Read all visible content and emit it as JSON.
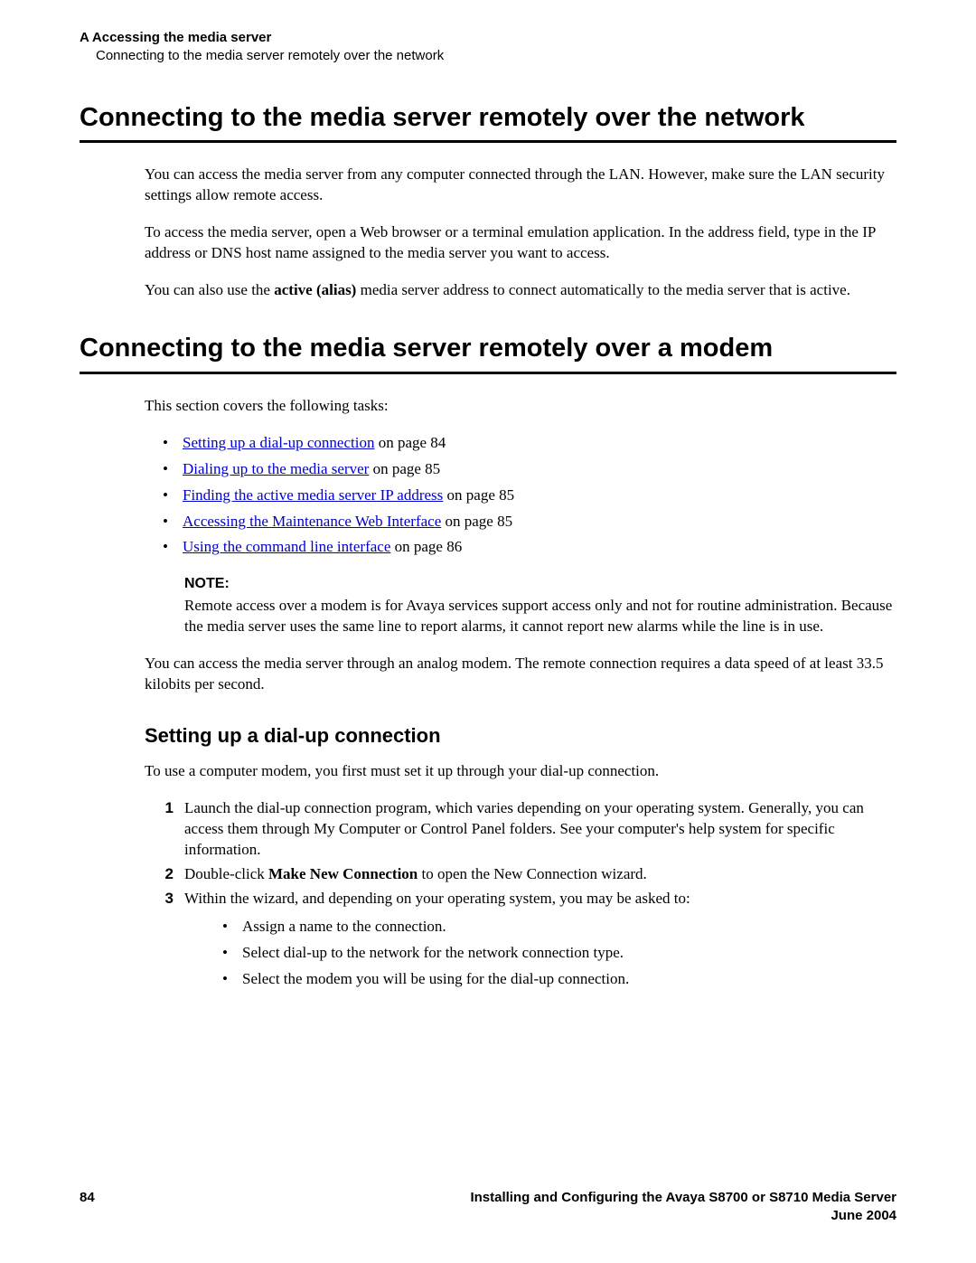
{
  "header": {
    "appendix": "A",
    "chapter": "Accessing the media server",
    "subtitle": "Connecting to the media server remotely over the network"
  },
  "section1": {
    "title": "Connecting to the media server remotely over the network",
    "p1": "You can access the media server from any computer connected through the LAN. However, make sure the LAN security settings allow remote access.",
    "p2": "To access the media server, open a Web browser or a terminal emulation application. In the address field, type in the IP address or DNS host name assigned to the media server you want to access.",
    "p3a": "You can also use the ",
    "p3bold": "active (alias)",
    "p3b": " media server address to connect automatically to the media server that is active."
  },
  "section2": {
    "title": "Connecting to the media server remotely over a modem",
    "intro": "This section covers the following tasks:",
    "links": [
      {
        "text": "Setting up a dial-up connection",
        "suffix": " on page 84"
      },
      {
        "text": "Dialing up to the media server",
        "suffix": " on page 85"
      },
      {
        "text": "Finding the active media server IP address",
        "suffix": " on page 85"
      },
      {
        "text": "Accessing the Maintenance Web Interface",
        "suffix": " on page 85"
      },
      {
        "text": "Using the command line interface",
        "suffix": " on page 86"
      }
    ],
    "note_label": "NOTE:",
    "note": "Remote access over a modem is for Avaya services support access only and not for routine administration. Because the media server uses the same line to report alarms, it cannot report new alarms while the line is in use.",
    "p_after": "You can access the media server through an analog modem. The remote connection requires a data speed of at least 33.5 kilobits per second."
  },
  "section3": {
    "title": "Setting up a dial-up connection",
    "intro": "To use a computer modem, you first must set it up through your dial-up connection.",
    "step1": "Launch the dial-up connection program, which varies depending on your operating system. Generally, you can access them through My Computer or Control Panel folders. See your computer's help system for specific information.",
    "step2a": "Double-click ",
    "step2bold": "Make New Connection",
    "step2b": " to open the New Connection wizard.",
    "step3": "Within the wizard, and depending on your operating system, you may be asked to:",
    "sub": [
      "Assign a name to the connection.",
      "Select dial-up to the network for the network connection type.",
      "Select the modem you will be using for the dial-up connection."
    ]
  },
  "footer": {
    "page": "84",
    "doc_title": "Installing and Configuring the Avaya S8700 or S8710 Media Server",
    "date": "June 2004"
  }
}
